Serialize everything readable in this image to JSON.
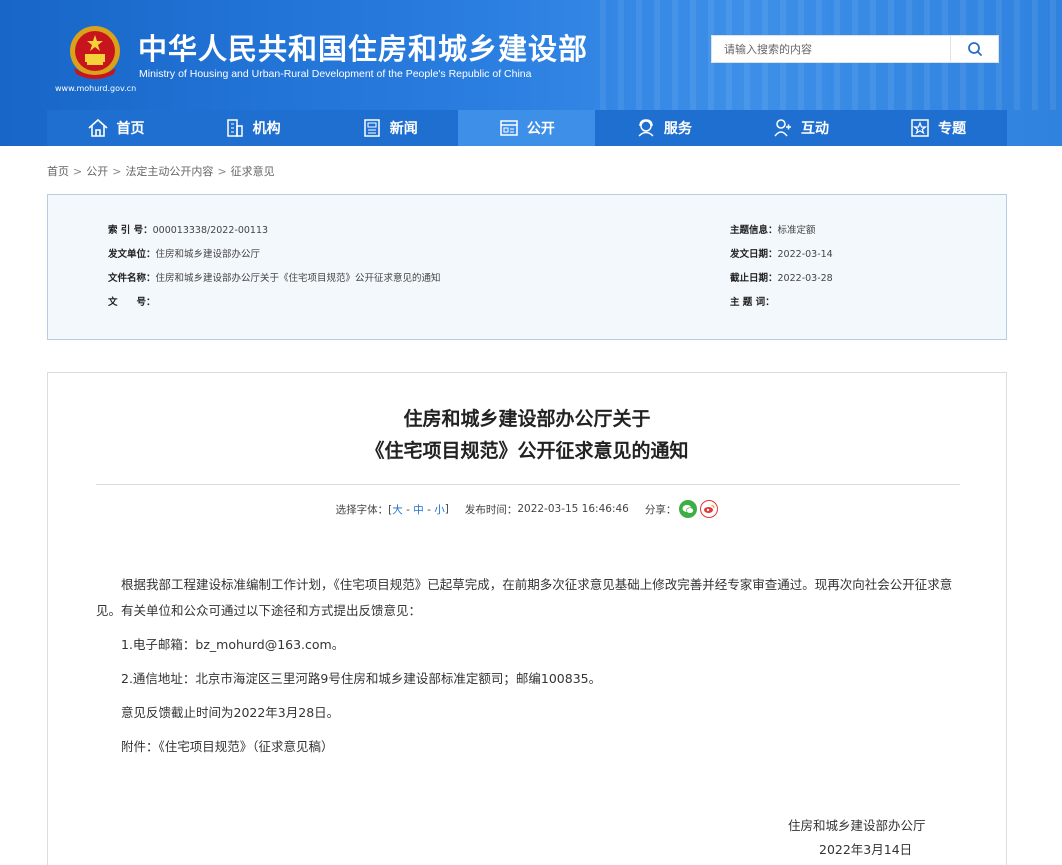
{
  "header": {
    "site_title": "中华人民共和国住房和城乡建设部",
    "site_subtitle": "Ministry of Housing and Urban-Rural Development of the People's Republic of China",
    "site_url": "www.mohurd.gov.cn",
    "search_placeholder": "请输入搜索的内容"
  },
  "nav": [
    {
      "label": "首页",
      "icon": "home-icon"
    },
    {
      "label": "机构",
      "icon": "building-icon"
    },
    {
      "label": "新闻",
      "icon": "news-icon"
    },
    {
      "label": "公开",
      "icon": "open-icon",
      "active": true
    },
    {
      "label": "服务",
      "icon": "service-icon"
    },
    {
      "label": "互动",
      "icon": "interaction-icon"
    },
    {
      "label": "专题",
      "icon": "topic-icon"
    }
  ],
  "breadcrumb": [
    "首页",
    "公开",
    "法定主动公开内容",
    "征求意见"
  ],
  "meta": {
    "index_label": "索 引 号：",
    "index_value": "000013338/2022-00113",
    "issuer_label": "发文单位：",
    "issuer_value": "住房和城乡建设部办公厅",
    "docname_label": "文件名称：",
    "docname_value": "住房和城乡建设部办公厅关于《住宅项目规范》公开征求意见的通知",
    "docno_label": "文　　号：",
    "docno_value": "",
    "topic_label": "主题信息：",
    "topic_value": "标准定额",
    "date_label": "发文日期：",
    "date_value": "2022-03-14",
    "deadline_label": "截止日期：",
    "deadline_value": "2022-03-28",
    "keywords_label": "主 题 词：",
    "keywords_value": ""
  },
  "article": {
    "title_line1": "住房和城乡建设部办公厅关于",
    "title_line2": "《住宅项目规范》公开征求意见的通知",
    "font_label": "选择字体：[",
    "font_large": "大",
    "font_medium": "中",
    "font_small": "小",
    "font_end": "]",
    "dash": "-",
    "publish_label": "发布时间：",
    "publish_time": "2022-03-15 16:46:46",
    "share_label": "分享：",
    "paragraphs": [
      "根据我部工程建设标准编制工作计划，《住宅项目规范》已起草完成，在前期多次征求意见基础上修改完善并经专家审查通过。现再次向社会公开征求意见。有关单位和公众可通过以下途径和方式提出反馈意见：",
      "1.电子邮箱：bz_mohurd@163.com。",
      "2.通信地址：北京市海淀区三里河路9号住房和城乡建设部标准定额司；邮编100835。",
      "意见反馈截止时间为2022年3月28日。",
      "附件：《住宅项目规范》（征求意见稿）"
    ],
    "sign_org": "住房和城乡建设部办公厅",
    "sign_date": "2022年3月14日"
  }
}
